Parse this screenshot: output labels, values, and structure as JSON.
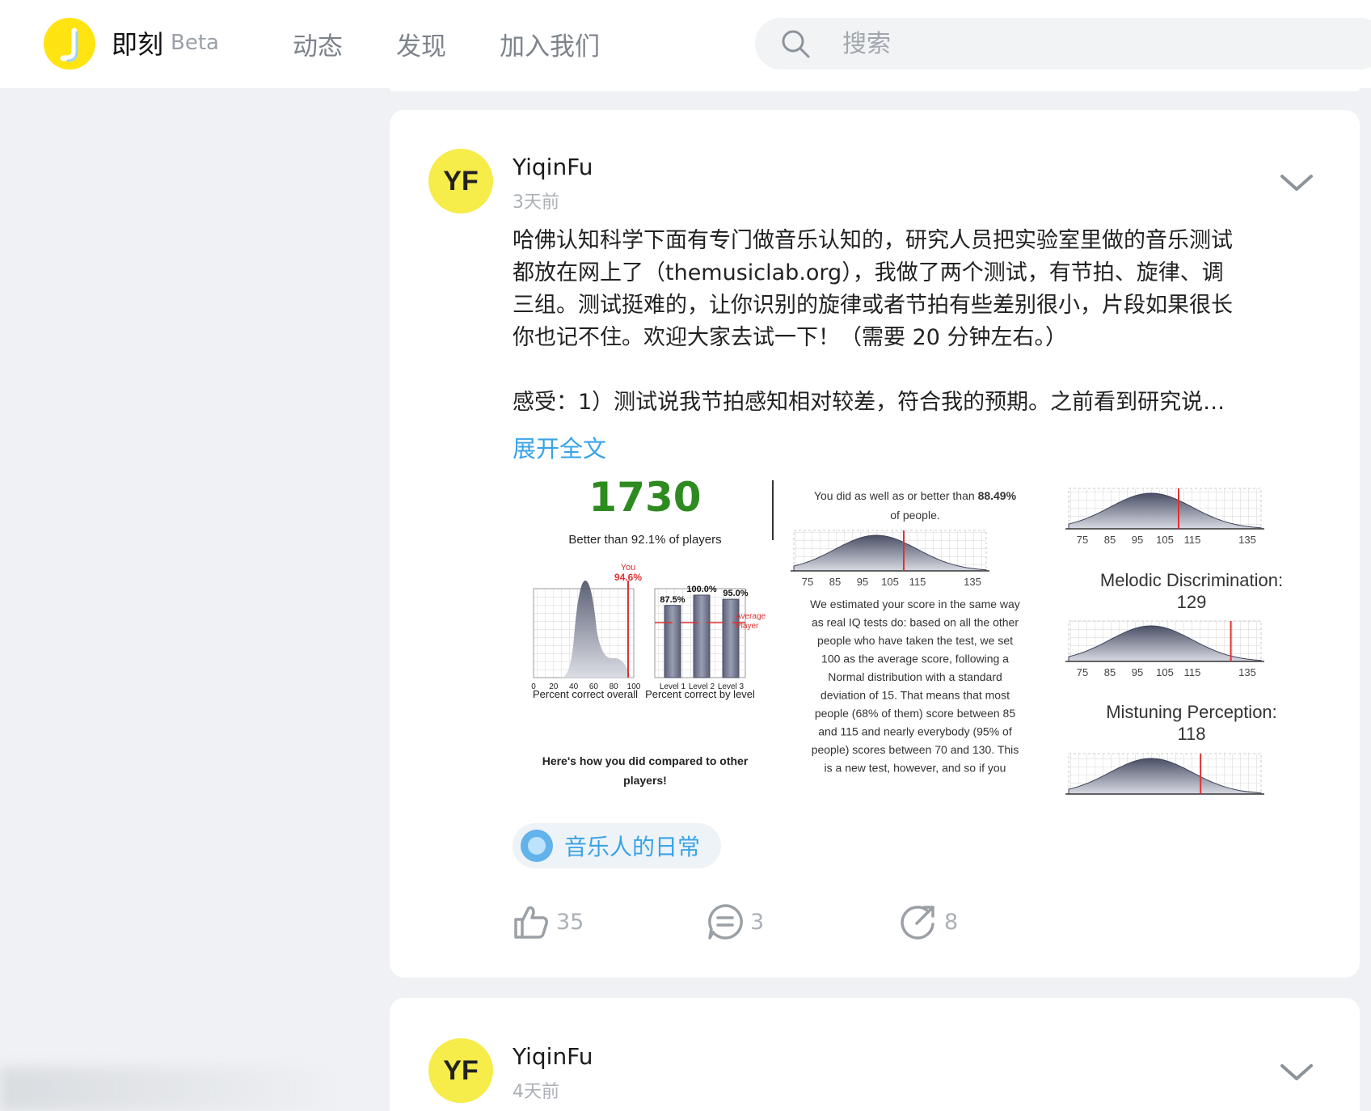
{
  "header": {
    "brand": "即刻",
    "beta": "Beta",
    "logo_icon": "jike-logo-icon",
    "nav": [
      "动态",
      "发现",
      "加入我们"
    ],
    "search_placeholder": "搜索"
  },
  "posts": [
    {
      "avatar_text": "YF",
      "username": "YiqinFu",
      "time": "3天前",
      "text_lines": [
        "哈佛认知科学下面有专门做音乐认知的，研究人员把实验室里做的音乐测试",
        "都放在网上了（themusiclab.org），我做了两个测试，有节拍、旋律、调",
        "三组。测试挺难的，让你识别的旋律或者节拍有些差别很小，片段如果很长",
        "你也记不住。欢迎大家去试一下！（需要 20 分钟左右。）",
        "感受：1）测试说我节拍感知相对较差，符合我的预期。之前看到研究说…"
      ],
      "expand_label": "展开全文",
      "image": {
        "score": "1730",
        "better_than": "Better than 92.1% of players",
        "you_label": "You",
        "you_pct": "94.6%",
        "overall_xticks": [
          "0",
          "20",
          "40",
          "60",
          "80",
          "100"
        ],
        "overall_caption": "Percent correct overall",
        "level_values": [
          87.5,
          100.0,
          95.0
        ],
        "level_labels": [
          "87.5%",
          "100.0%",
          "95.0%"
        ],
        "level_ticks": [
          "Level 1",
          "Level 2",
          "Level 3"
        ],
        "level_caption": "Percent correct by level",
        "average_label": [
          "Average",
          "Player"
        ],
        "compare_text": [
          "Here's how you did compared to other",
          "players!"
        ],
        "middle_header": [
          "You did as well as or better than 88.49%",
          "of people."
        ],
        "middle_header_plain": "You did as well as or better than ",
        "middle_header_bold": "88.49%",
        "middle_header_line2": "of people.",
        "iq_ticks": [
          "75",
          "85",
          "95",
          "105",
          "115",
          "135"
        ],
        "middle_paragraph": [
          "We estimated your score in the same way",
          "as real IQ tests do: based on all the other",
          "people who have taken the test, we set",
          "100 as the average score, following a",
          "Normal distribution with a standard",
          "deviation of 15. That means that most",
          "people (68% of them) score between 85",
          "and 115 and nearly everybody (95% of",
          "people) scores between 70 and 130. This",
          "is a new test, however, and so if you"
        ],
        "melodic_title": "Melodic Discrimination:",
        "melodic_score": "129",
        "mistuning_title": "Mistuning Perception:",
        "mistuning_score": "118",
        "percentile_rank": 88.49,
        "beat_score_marker": 110,
        "melodic_score_marker": 129,
        "mistuning_score_marker": 118
      },
      "topic": "音乐人的日常",
      "actions": {
        "likes": "35",
        "comments": "3",
        "shares": "8"
      }
    },
    {
      "avatar_text": "YF",
      "username": "YiqinFu",
      "time": "4天前"
    }
  ],
  "colors": {
    "accent_blue": "#3aa3e8",
    "logo_yellow": "#ffe411",
    "avatar_yellow": "#f6ec4a",
    "score_green": "#2e8b1f",
    "marker_red": "#e03131"
  }
}
